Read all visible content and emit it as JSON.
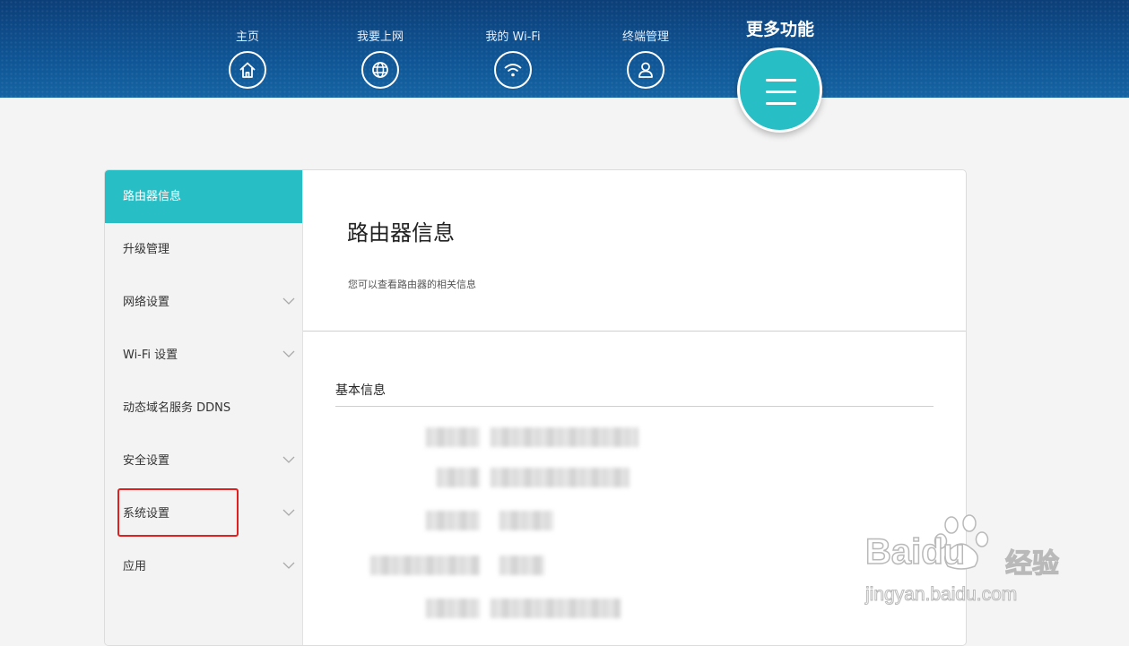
{
  "nav": {
    "items": [
      {
        "label": "主页",
        "icon": "home-icon"
      },
      {
        "label": "我要上网",
        "icon": "globe-icon"
      },
      {
        "label": "我的 Wi-Fi",
        "icon": "wifi-icon"
      },
      {
        "label": "终端管理",
        "icon": "user-icon"
      }
    ],
    "more_label": "更多功能",
    "more_icon": "menu-icon"
  },
  "sidebar": {
    "items": [
      {
        "label": "路由器信息",
        "active": true,
        "has_chevron": false
      },
      {
        "label": "升级管理",
        "active": false,
        "has_chevron": false
      },
      {
        "label": "网络设置",
        "active": false,
        "has_chevron": true
      },
      {
        "label": "Wi-Fi 设置",
        "active": false,
        "has_chevron": true
      },
      {
        "label": "动态域名服务 DDNS",
        "active": false,
        "has_chevron": false
      },
      {
        "label": "安全设置",
        "active": false,
        "has_chevron": true
      },
      {
        "label": "系统设置",
        "active": false,
        "has_chevron": true
      },
      {
        "label": "应用",
        "active": false,
        "has_chevron": true
      }
    ]
  },
  "content": {
    "title": "路由器信息",
    "subtitle": "您可以查看路由器的相关信息",
    "section_title": "基本信息"
  },
  "watermark": {
    "brand": "Baidu",
    "cn": "经验",
    "url": "jingyan.baidu.com"
  },
  "colors": {
    "header_bg": "#0f5595",
    "accent": "#27bfc5",
    "highlight": "#e02020"
  }
}
